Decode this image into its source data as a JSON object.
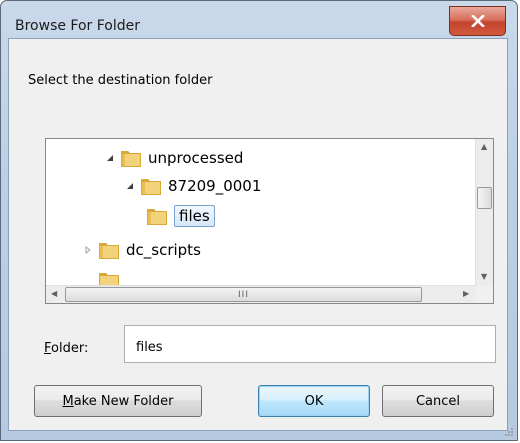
{
  "window": {
    "title": "Browse For Folder"
  },
  "prompt": "Select the destination folder",
  "tree": {
    "items": [
      {
        "label": "unprocessed",
        "state": "expanded"
      },
      {
        "label": "87209_0001",
        "state": "expanded"
      },
      {
        "label": "files",
        "state": "selected"
      },
      {
        "label": "dc_scripts",
        "state": "collapsed"
      }
    ],
    "hscroll_grip": "III"
  },
  "folder_field": {
    "label_accel": "F",
    "label_rest": "older:",
    "value": "files"
  },
  "buttons": {
    "make_new_folder_accel": "M",
    "make_new_folder_rest": "ake New Folder",
    "ok": "OK",
    "cancel": "Cancel"
  },
  "colors": {
    "close_button": "#c2442c",
    "selection": "#d5e7fa",
    "folder": "#e8c25a"
  }
}
